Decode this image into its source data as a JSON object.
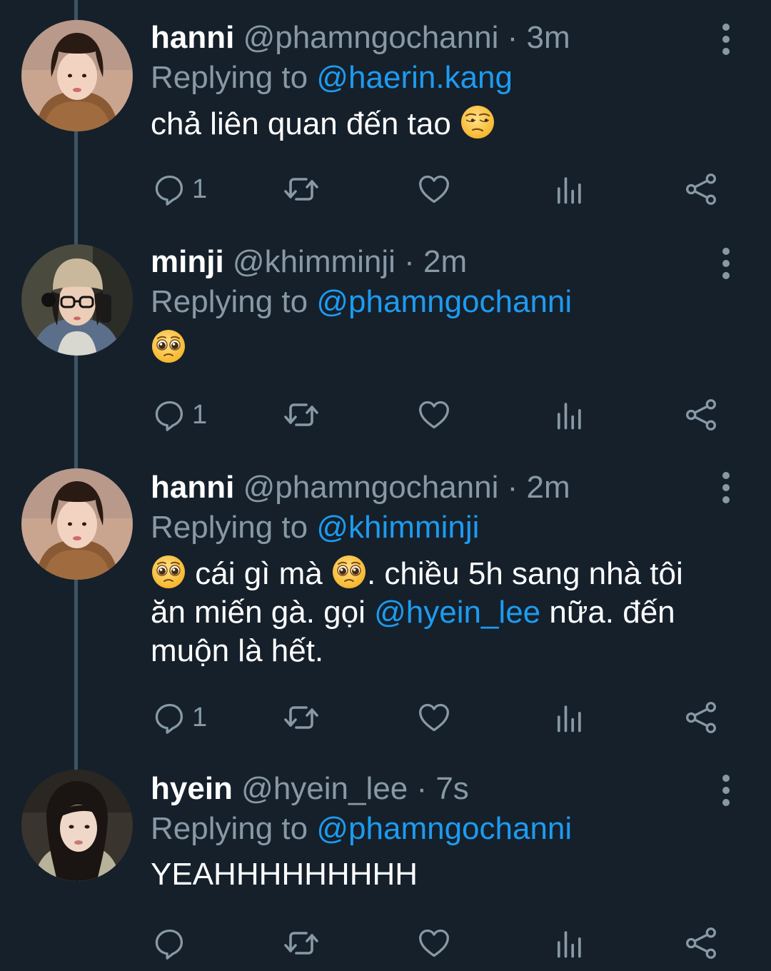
{
  "colors": {
    "background": "#15202b",
    "secondary_text": "#8899a6",
    "link": "#1d9bf0",
    "thread_line": "#3d5466"
  },
  "tweets": [
    {
      "name": "hanni",
      "handle": "@phamngochanni",
      "time": "· 3m",
      "replying_label": "Replying to",
      "replying_to": "@haerin.kang",
      "text_part1": "chả liên quan đến tao",
      "reply_count": "1"
    },
    {
      "name": "minji",
      "handle": "@khimminji",
      "time": "· 2m",
      "replying_label": "Replying to",
      "replying_to": "@phamngochanni",
      "reply_count": "1"
    },
    {
      "name": "hanni",
      "handle": "@phamngochanni",
      "time": "· 2m",
      "replying_label": "Replying to",
      "replying_to": "@khimminji",
      "text_part1": "cái gì mà",
      "text_part2": ". chiều 5h sang nhà tôi ăn miến gà. gọi",
      "mention": "@hyein_lee",
      "text_part3": "nữa. đến muộn là hết.",
      "reply_count": "1"
    },
    {
      "name": "hyein",
      "handle": "@hyein_lee",
      "time": "· 7s",
      "replying_label": "Replying to",
      "replying_to": "@phamngochanni",
      "text_part1": "YEAHHHHHHHHH",
      "reply_count": ""
    }
  ],
  "icons": {
    "reply": "reply-icon",
    "retweet": "retweet-icon",
    "like": "heart-icon",
    "analytics": "analytics-icon",
    "share": "share-icon",
    "more": "more-vertical-icon"
  }
}
